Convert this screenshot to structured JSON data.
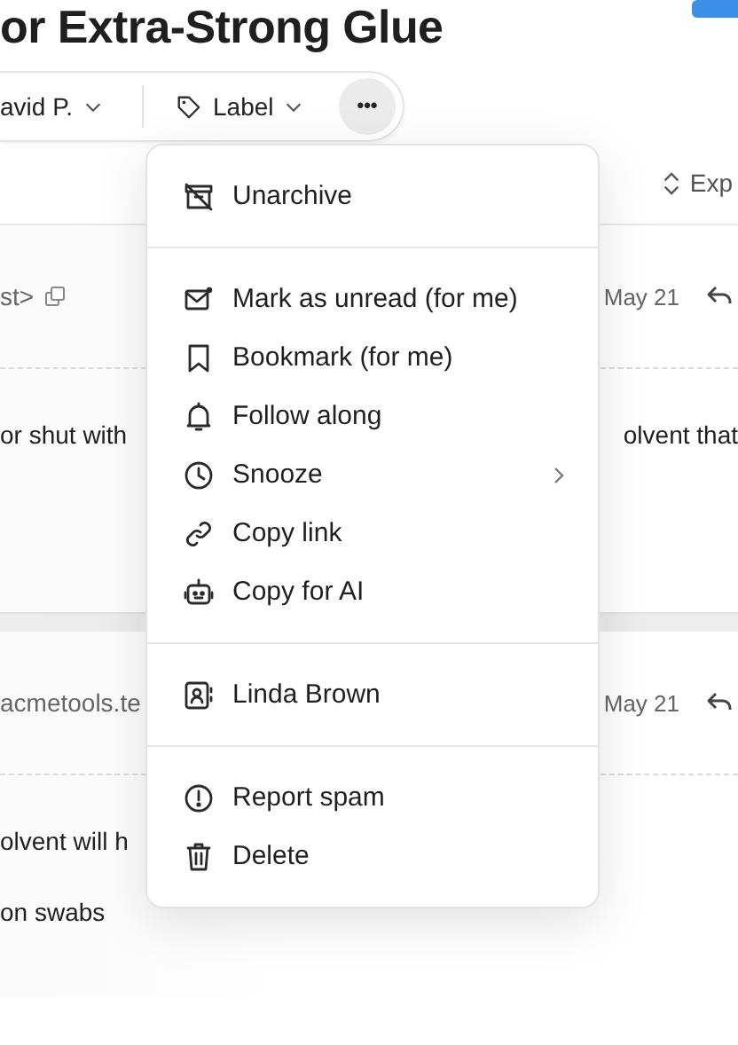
{
  "title": "or Extra-Strong Glue",
  "toolbar": {
    "assignee": "avid P.",
    "label": "Label",
    "more": "•••",
    "more_selected": true
  },
  "expand": "Exp",
  "emails": [
    {
      "sender": "st>",
      "date": "May 21",
      "body": [
        "or shut with",
        "olvent that"
      ]
    },
    {
      "sender": "acmetools.te",
      "date": "May 21",
      "body": [
        "olvent will h",
        "on swabs"
      ]
    }
  ],
  "menu": {
    "sections": [
      [
        {
          "label": "Unarchive",
          "submenu": false
        }
      ],
      [
        {
          "label": "Mark as unread (for me)",
          "submenu": false
        },
        {
          "label": "Bookmark (for me)",
          "submenu": false
        },
        {
          "label": "Follow along",
          "submenu": false
        },
        {
          "label": "Snooze",
          "submenu": true
        },
        {
          "label": "Copy link",
          "submenu": false
        },
        {
          "label": "Copy for AI",
          "submenu": false
        }
      ],
      [
        {
          "label": "Linda Brown",
          "submenu": false
        }
      ],
      [
        {
          "label": "Report spam",
          "submenu": false
        },
        {
          "label": "Delete",
          "submenu": false
        }
      ]
    ]
  }
}
